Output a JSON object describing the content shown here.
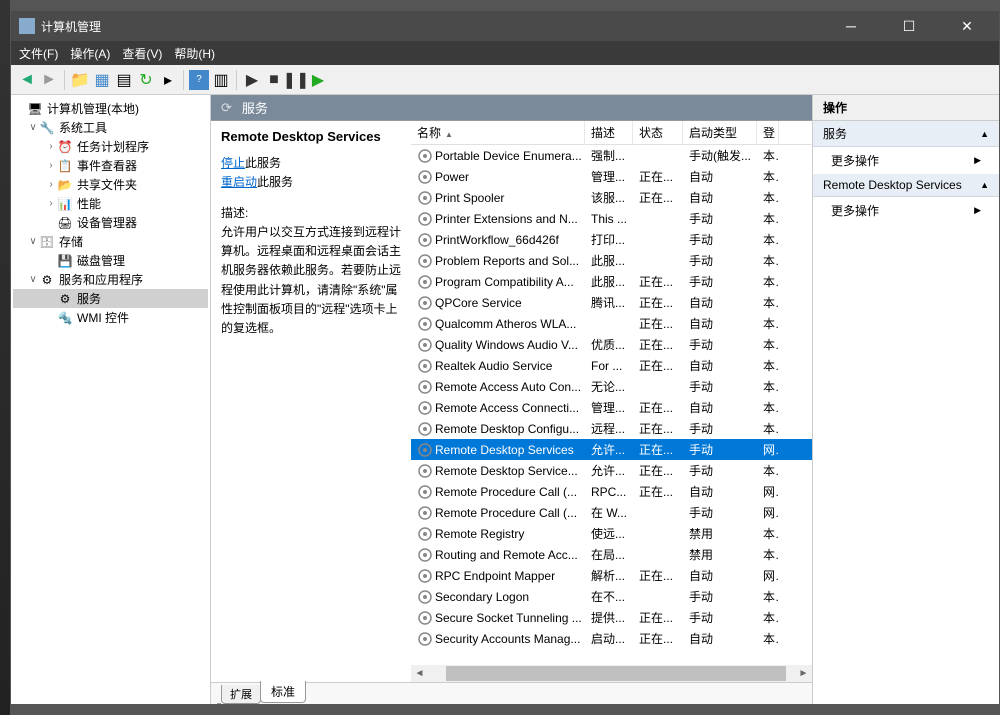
{
  "window": {
    "title": "计算机管理"
  },
  "menu": {
    "file": "文件(F)",
    "action": "操作(A)",
    "view": "查看(V)",
    "help": "帮助(H)"
  },
  "tree": {
    "root": "计算机管理(本地)",
    "sys_tools": "系统工具",
    "task_sched": "任务计划程序",
    "event_viewer": "事件查看器",
    "shared_folders": "共享文件夹",
    "performance": "性能",
    "device_mgr": "设备管理器",
    "storage": "存储",
    "disk_mgmt": "磁盘管理",
    "services_apps": "服务和应用程序",
    "services": "服务",
    "wmi": "WMI 控件"
  },
  "middle": {
    "header": "服务",
    "detail_title": "Remote Desktop Services",
    "stop_link": "停止",
    "stop_suffix": "此服务",
    "restart_link": "重启动",
    "restart_suffix": "此服务",
    "desc_label": "描述:",
    "desc": "允许用户以交互方式连接到远程计算机。远程桌面和远程桌面会话主机服务器依赖此服务。若要防止远程使用此计算机，请清除\"系统\"属性控制面板项目的\"远程\"选项卡上的复选框。"
  },
  "columns": {
    "name": "名称",
    "desc": "描述",
    "status": "状态",
    "startup": "启动类型",
    "logon": "登"
  },
  "col_widths": {
    "name": 174,
    "desc": 48,
    "status": 50,
    "startup": 74,
    "logon": 22
  },
  "services": [
    {
      "name": "Portable Device Enumera...",
      "desc": "强制...",
      "status": "",
      "startup": "手动(触发...",
      "logon": "本"
    },
    {
      "name": "Power",
      "desc": "管理...",
      "status": "正在...",
      "startup": "自动",
      "logon": "本"
    },
    {
      "name": "Print Spooler",
      "desc": "该服...",
      "status": "正在...",
      "startup": "自动",
      "logon": "本"
    },
    {
      "name": "Printer Extensions and N...",
      "desc": "This ...",
      "status": "",
      "startup": "手动",
      "logon": "本"
    },
    {
      "name": "PrintWorkflow_66d426f",
      "desc": "打印...",
      "status": "",
      "startup": "手动",
      "logon": "本"
    },
    {
      "name": "Problem Reports and Sol...",
      "desc": "此服...",
      "status": "",
      "startup": "手动",
      "logon": "本"
    },
    {
      "name": "Program Compatibility A...",
      "desc": "此服...",
      "status": "正在...",
      "startup": "手动",
      "logon": "本"
    },
    {
      "name": "QPCore Service",
      "desc": "腾讯...",
      "status": "正在...",
      "startup": "自动",
      "logon": "本"
    },
    {
      "name": "Qualcomm Atheros WLA...",
      "desc": "",
      "status": "正在...",
      "startup": "自动",
      "logon": "本"
    },
    {
      "name": "Quality Windows Audio V...",
      "desc": "优质...",
      "status": "正在...",
      "startup": "手动",
      "logon": "本"
    },
    {
      "name": "Realtek Audio Service",
      "desc": "For ...",
      "status": "正在...",
      "startup": "自动",
      "logon": "本"
    },
    {
      "name": "Remote Access Auto Con...",
      "desc": "无论...",
      "status": "",
      "startup": "手动",
      "logon": "本"
    },
    {
      "name": "Remote Access Connecti...",
      "desc": "管理...",
      "status": "正在...",
      "startup": "自动",
      "logon": "本"
    },
    {
      "name": "Remote Desktop Configu...",
      "desc": "远程...",
      "status": "正在...",
      "startup": "手动",
      "logon": "本"
    },
    {
      "name": "Remote Desktop Services",
      "desc": "允许...",
      "status": "正在...",
      "startup": "手动",
      "logon": "网",
      "selected": true
    },
    {
      "name": "Remote Desktop Service...",
      "desc": "允许...",
      "status": "正在...",
      "startup": "手动",
      "logon": "本"
    },
    {
      "name": "Remote Procedure Call (...",
      "desc": "RPC...",
      "status": "正在...",
      "startup": "自动",
      "logon": "网"
    },
    {
      "name": "Remote Procedure Call (...",
      "desc": "在 W...",
      "status": "",
      "startup": "手动",
      "logon": "网"
    },
    {
      "name": "Remote Registry",
      "desc": "使远...",
      "status": "",
      "startup": "禁用",
      "logon": "本"
    },
    {
      "name": "Routing and Remote Acc...",
      "desc": "在局...",
      "status": "",
      "startup": "禁用",
      "logon": "本"
    },
    {
      "name": "RPC Endpoint Mapper",
      "desc": "解析...",
      "status": "正在...",
      "startup": "自动",
      "logon": "网"
    },
    {
      "name": "Secondary Logon",
      "desc": "在不...",
      "status": "",
      "startup": "手动",
      "logon": "本"
    },
    {
      "name": "Secure Socket Tunneling ...",
      "desc": "提供...",
      "status": "正在...",
      "startup": "手动",
      "logon": "本"
    },
    {
      "name": "Security Accounts Manag...",
      "desc": "启动...",
      "status": "正在...",
      "startup": "自动",
      "logon": "本"
    }
  ],
  "tabs": {
    "ext": "扩展",
    "std": "标准"
  },
  "right": {
    "header": "操作",
    "section1": "服务",
    "more_actions": "更多操作",
    "section2": "Remote Desktop Services"
  }
}
